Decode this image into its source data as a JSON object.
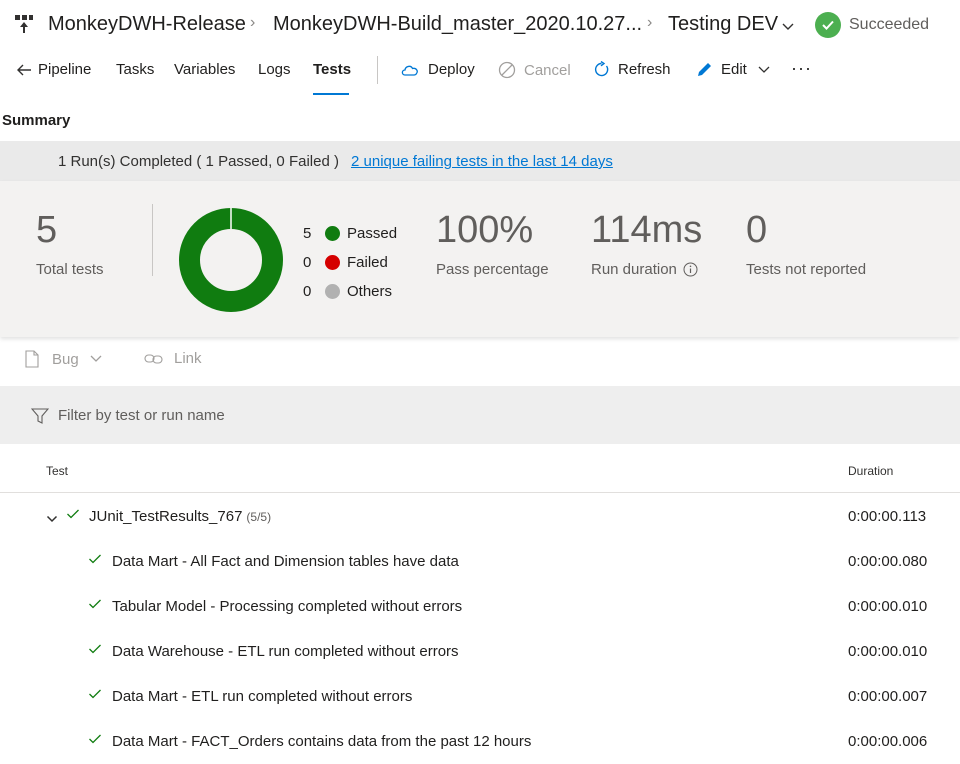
{
  "breadcrumb": {
    "pipeline": "MonkeyDWH-Release",
    "release": "MonkeyDWH-Build_master_2020.10.27...",
    "stage": "Testing DEV",
    "status": "Succeeded"
  },
  "tabs": {
    "pipeline": "Pipeline",
    "tasks": "Tasks",
    "variables": "Variables",
    "logs": "Logs",
    "tests": "Tests"
  },
  "toolbar": {
    "deploy": "Deploy",
    "cancel": "Cancel",
    "refresh": "Refresh",
    "edit": "Edit",
    "more": "···"
  },
  "summary": {
    "title": "Summary",
    "run_text": "1 Run(s) Completed ( 1 Passed, 0 Failed )",
    "run_link": "2 unique failing tests in the last 14 days",
    "total_tests": "5",
    "total_tests_label": "Total tests",
    "legend": [
      {
        "count": "5",
        "label": "Passed",
        "color": "#107c10"
      },
      {
        "count": "0",
        "label": "Failed",
        "color": "#d50000"
      },
      {
        "count": "0",
        "label": "Others",
        "color": "#b1b1b1"
      }
    ],
    "pass_pct": "100%",
    "pass_pct_label": "Pass percentage",
    "run_duration": "114ms",
    "run_duration_label": "Run duration",
    "not_reported": "0",
    "not_reported_label": "Tests not reported"
  },
  "actions": {
    "bug": "Bug",
    "link": "Link"
  },
  "filter": {
    "placeholder": "Filter by test or run name"
  },
  "table": {
    "col_test": "Test",
    "col_duration": "Duration",
    "group": {
      "name": "JUnit_TestResults_767",
      "count": "(5/5)",
      "duration": "0:00:00.113"
    },
    "rows": [
      {
        "name": "Data Mart - All Fact and Dimension tables have data",
        "duration": "0:00:00.080"
      },
      {
        "name": "Tabular Model - Processing completed without errors",
        "duration": "0:00:00.010"
      },
      {
        "name": "Data Warehouse - ETL run completed without errors",
        "duration": "0:00:00.010"
      },
      {
        "name": "Data Mart - ETL run completed without errors",
        "duration": "0:00:00.007"
      },
      {
        "name": "Data Mart - FACT_Orders contains data from the past 12 hours",
        "duration": "0:00:00.006"
      }
    ]
  },
  "colors": {
    "accent": "#0078d4",
    "success": "#4caf50",
    "pass": "#107c10"
  }
}
